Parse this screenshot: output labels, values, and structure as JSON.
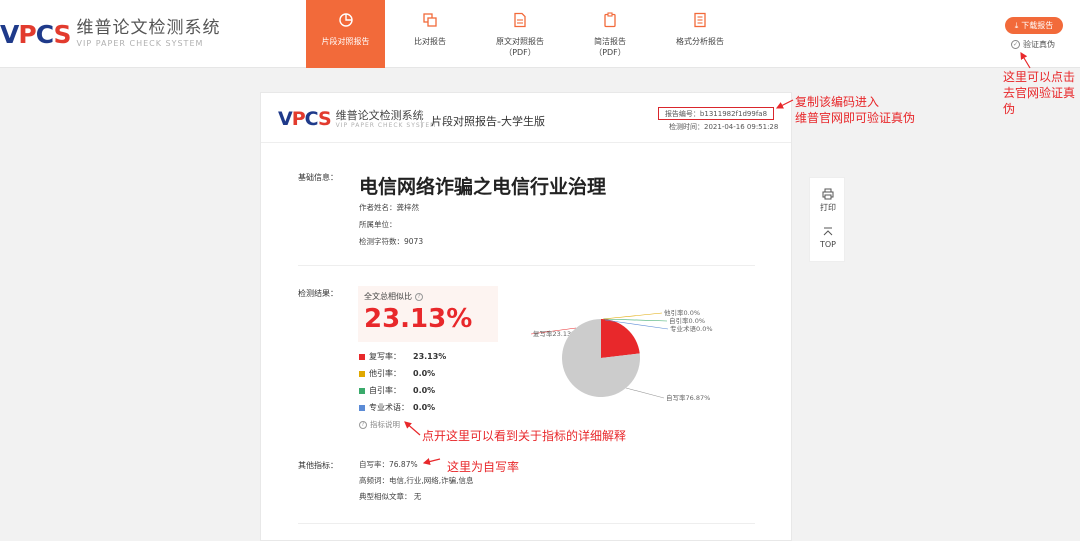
{
  "header": {
    "logo_mark": "VPCS",
    "logo_cn": "维普论文检测系统",
    "logo_en": "VIP PAPER CHECK SYSTEM",
    "tabs": [
      {
        "label": "片段对照报告",
        "sub": "",
        "icon": "pie-chart-icon",
        "active": true
      },
      {
        "label": "比对报告",
        "sub": "",
        "icon": "copy-icon",
        "active": false
      },
      {
        "label": "原文对照报告",
        "sub": "（PDF）",
        "icon": "document-icon",
        "active": false
      },
      {
        "label": "简洁报告",
        "sub": "（PDF）",
        "icon": "clipboard-icon",
        "active": false
      },
      {
        "label": "格式分析报告",
        "sub": "",
        "icon": "book-icon",
        "active": false
      }
    ],
    "download_label": "下载报告",
    "verify_label": "验证真伪"
  },
  "report": {
    "logo_mark": "VPCS",
    "logo_cn": "维普论文检测系统",
    "logo_en": "VIP PAPER CHECK SYSTEM",
    "edition": "片段对照报告-大学生版",
    "report_no": "报告编号：b1311982f1d99fa8",
    "check_time": "检测时间：2021-04-16 09:51:28",
    "basic_label": "基础信息：",
    "title": "电信网络诈骗之电信行业治理",
    "author": "作者姓名：龚梓然",
    "unit": "所属单位：",
    "chars": "检测字符数：9073",
    "result_label": "检测结果：",
    "similarity_label": "全文总相似比",
    "similarity_value": "23.13%",
    "legend": [
      {
        "label": "复写率：",
        "value": "23.13%",
        "color": "#e8282b"
      },
      {
        "label": "他引率：",
        "value": "0.0%",
        "color": "#e0a800"
      },
      {
        "label": "自引率：",
        "value": "0.0%",
        "color": "#3aaa6b"
      },
      {
        "label": "专业术语：",
        "value": "0.0%",
        "color": "#5b8bd6"
      }
    ],
    "explain_link": "指标说明",
    "other_label": "其他指标：",
    "self_write": "自写率：76.87%",
    "keywords": "高频词：电信,行业,网络,诈骗,信息",
    "similar_docs": "典型相似文章： 无"
  },
  "chart_data": {
    "type": "pie",
    "slices": [
      {
        "label": "复写率23.13%",
        "value": 23.13,
        "color": "#e8282b"
      },
      {
        "label": "他引率0.0%",
        "value": 0.0,
        "color": "#e0a800"
      },
      {
        "label": "自引率0.0%",
        "value": 0.0,
        "color": "#3aaa6b"
      },
      {
        "label": "专业术语0.0%",
        "value": 0.0,
        "color": "#5b8bd6"
      },
      {
        "label": "自写率76.87%",
        "value": 76.87,
        "color": "#cccccc"
      }
    ]
  },
  "sidetools": {
    "print_label": "打印",
    "top_label": "TOP"
  },
  "annotations": {
    "verify_note": "这里可以点击\n去官网验证真\n伪",
    "reportno_note": "复制该编码进入\n维普官网即可验证真伪",
    "explain_note": "点开这里可以看到关于指标的详细解释",
    "selfwrite_note": "这里为自写率"
  }
}
